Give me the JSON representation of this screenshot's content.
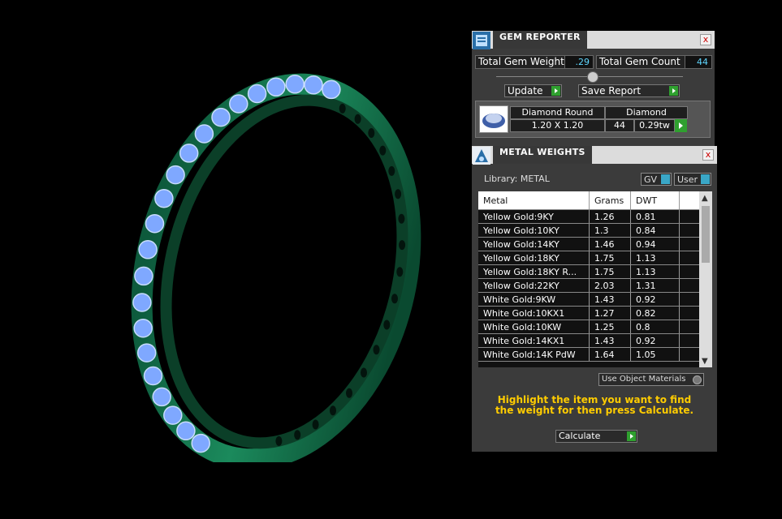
{
  "gem_reporter": {
    "title": "GEM REPORTER",
    "close": "x",
    "total_gem_weight_label": "Total Gem Weight",
    "total_gem_weight_value": ".29",
    "total_gem_count_label": "Total Gem Count",
    "total_gem_count_value": "44",
    "update_label": "Update",
    "save_report_label": "Save Report",
    "gem_row": {
      "shape": "Diamond Round",
      "material": "Diamond",
      "size": "1.20 X 1.20",
      "count": "44",
      "weight": "0.29tw"
    }
  },
  "metal_weights": {
    "title": "METAL WEIGHTS",
    "close": "x",
    "library_label": "Library: METAL",
    "gv_label": "GV",
    "user_label": "User",
    "columns": [
      "Metal",
      "Grams",
      "DWT"
    ],
    "rows": [
      [
        "Yellow Gold:9KY",
        "1.26",
        "0.81"
      ],
      [
        "Yellow Gold:10KY",
        "1.3",
        "0.84"
      ],
      [
        "Yellow Gold:14KY",
        "1.46",
        "0.94"
      ],
      [
        "Yellow Gold:18KY",
        "1.75",
        "1.13"
      ],
      [
        "Yellow Gold:18KY R...",
        "1.75",
        "1.13"
      ],
      [
        "Yellow Gold:22KY",
        "2.03",
        "1.31"
      ],
      [
        "White Gold:9KW",
        "1.43",
        "0.92"
      ],
      [
        "White Gold:10KX1",
        "1.27",
        "0.82"
      ],
      [
        "White Gold:10KW",
        "1.25",
        "0.8"
      ],
      [
        "White Gold:14KX1",
        "1.43",
        "0.92"
      ],
      [
        "White Gold:14K PdW",
        "1.64",
        "1.05"
      ]
    ],
    "use_object_materials_label": "Use Object Materials",
    "hint": "Highlight the item you want to find the weight for then press Calculate.",
    "calculate_label": "Calculate"
  }
}
